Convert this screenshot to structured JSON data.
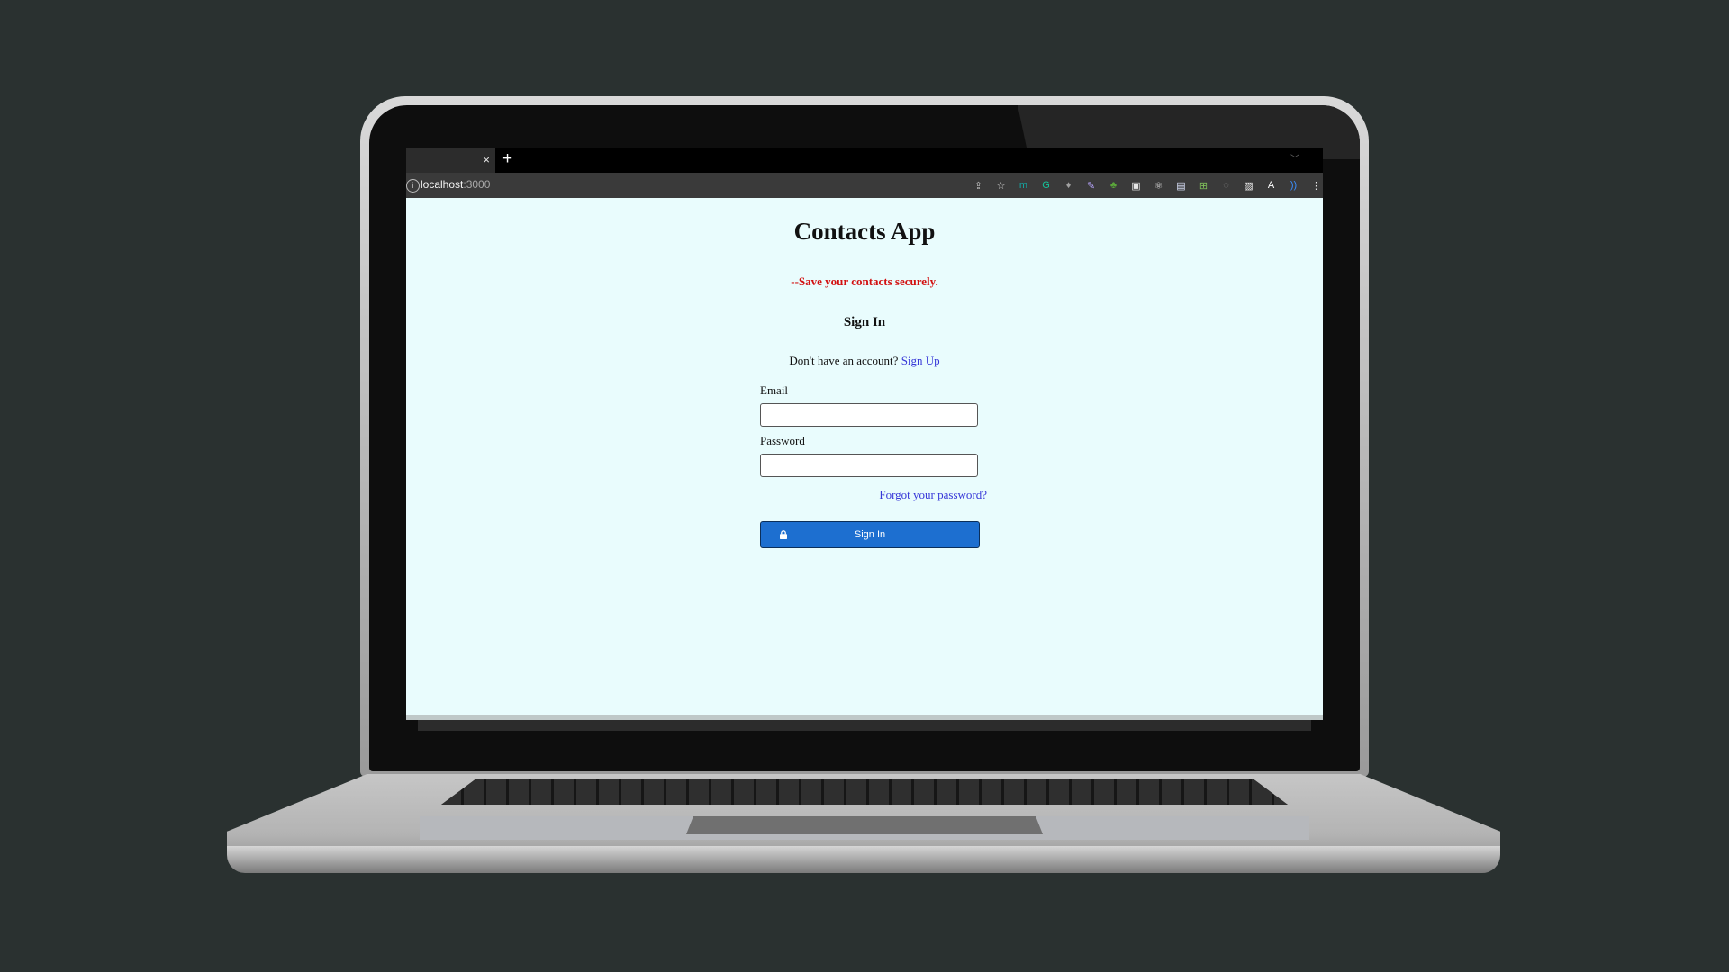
{
  "browser": {
    "tab_close_symbol": "×",
    "new_tab_symbol": "+",
    "url_host": "localhost",
    "url_port": ":3000",
    "toolbar_icons": [
      {
        "name": "share-icon",
        "glyph": "⇪",
        "color": "#cfcfcf"
      },
      {
        "name": "bookmark-star-icon",
        "glyph": "☆",
        "color": "#cfcfcf"
      },
      {
        "name": "extension-m-icon",
        "glyph": "m",
        "color": "#14a8a3"
      },
      {
        "name": "extension-grammarly-icon",
        "glyph": "G",
        "color": "#15c39a"
      },
      {
        "name": "extension-bulb-icon",
        "glyph": "♦",
        "color": "#a0a0a0"
      },
      {
        "name": "extension-eyedropper-icon",
        "glyph": "✎",
        "color": "#b9a7ff"
      },
      {
        "name": "extension-tree-icon",
        "glyph": "♣",
        "color": "#5aa53a"
      },
      {
        "name": "extension-record-icon",
        "glyph": "▣",
        "color": "#e6e6e6"
      },
      {
        "name": "extension-react-icon",
        "glyph": "⚛",
        "color": "#e6e6e6"
      },
      {
        "name": "extension-window-icon",
        "glyph": "▤",
        "color": "#dfe6ff"
      },
      {
        "name": "extension-translate-icon",
        "glyph": "⊞",
        "color": "#7fbf5a"
      },
      {
        "name": "extension-circle-icon",
        "glyph": "◌",
        "color": "#8c8c8c"
      },
      {
        "name": "extension-image-icon",
        "glyph": "▨",
        "color": "#f0f0f0"
      },
      {
        "name": "extension-a-icon",
        "glyph": "A",
        "color": "#ffffff"
      },
      {
        "name": "extension-wave-icon",
        "glyph": "))",
        "color": "#3b8fff"
      },
      {
        "name": "menu-dots-icon",
        "glyph": "⋮",
        "color": "#e6e6e6"
      }
    ]
  },
  "page": {
    "title": "Contacts App",
    "tagline": "--Save your contacts securely.",
    "signin_heading": "Sign In",
    "no_account_text": "Don't have an account? ",
    "signup_link": "Sign Up",
    "email_label": "Email",
    "email_value": "",
    "password_label": "Password",
    "password_value": "",
    "forgot_link": "Forgot your password?",
    "signin_button": "Sign In"
  },
  "colors": {
    "page_background": "#e9fcfd",
    "tagline": "#d21010",
    "link": "#3737d8",
    "button": "#1d6fd0",
    "desk_background": "#2a3130"
  }
}
